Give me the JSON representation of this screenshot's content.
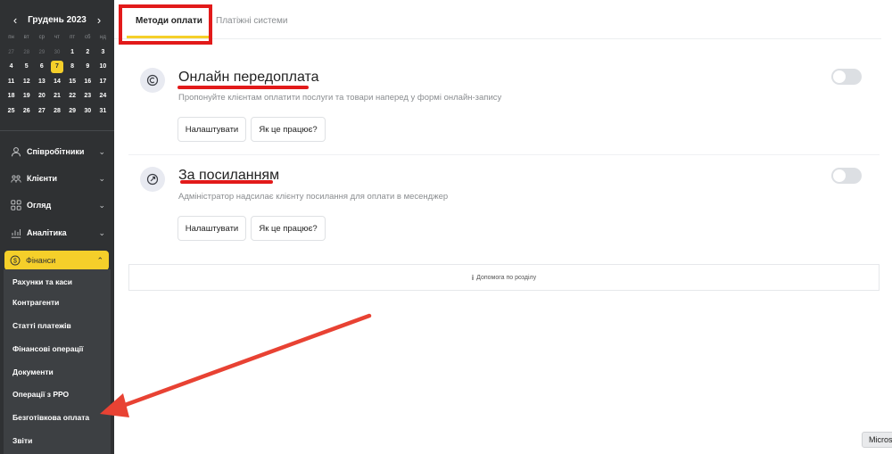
{
  "calendar": {
    "title": "Грудень 2023",
    "prev": "‹",
    "next": "›",
    "weekdays": [
      "пн",
      "вт",
      "ср",
      "чт",
      "пт",
      "сб",
      "нд"
    ],
    "weeks": [
      [
        "27",
        "28",
        "29",
        "30",
        "1",
        "2",
        "3"
      ],
      [
        "4",
        "5",
        "6",
        "7",
        "8",
        "9",
        "10"
      ],
      [
        "11",
        "12",
        "13",
        "14",
        "15",
        "16",
        "17"
      ],
      [
        "18",
        "19",
        "20",
        "21",
        "22",
        "23",
        "24"
      ],
      [
        "25",
        "26",
        "27",
        "28",
        "29",
        "30",
        "31"
      ]
    ],
    "selected_day": "7"
  },
  "nav": {
    "employees": "Співробітники",
    "clients": "Клієнти",
    "overview": "Огляд",
    "analytics": "Аналітика",
    "finance": "Фінанси"
  },
  "finance_menu": [
    "Рахунки та каси",
    "Контрагенти",
    "Статті платежів",
    "Фінансові операції",
    "Документи",
    "Операції з РРО",
    "Безготівкова оплата",
    "Звіти"
  ],
  "tabs": {
    "payment_methods": "Методи оплати",
    "payment_systems": "Платіжні системи"
  },
  "methods": [
    {
      "title": "Онлайн передоплата",
      "description": "Пропонуйте клієнтам оплатити послуги та товари наперед у формі онлайн-запису",
      "configure": "Налаштувати",
      "how": "Як це працює?",
      "enabled": false
    },
    {
      "title": "За посиланням",
      "description": "Адміністратор надсилає клієнту посилання для оплати в месенджер",
      "configure": "Налаштувати",
      "how": "Як це працює?",
      "enabled": false
    }
  ],
  "help": {
    "icon": "i",
    "label": "Допомога по розділу"
  },
  "corner_button": "Micros",
  "colors": {
    "sidebar": "#2f3133",
    "accent": "#f5cf2a",
    "annotation": "#e21a1a"
  }
}
